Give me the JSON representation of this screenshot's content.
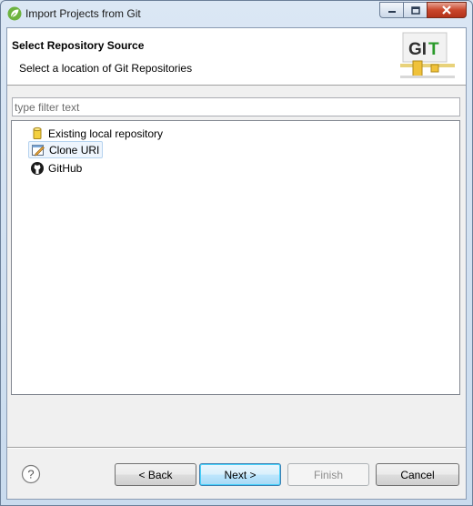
{
  "window": {
    "title": "Import Projects from Git",
    "app_icon": "spring-leaf-icon"
  },
  "banner": {
    "title": "Select Repository Source",
    "description": "Select a location of Git Repositories",
    "logo_text": "GIT"
  },
  "filter": {
    "placeholder": "type filter text",
    "value": ""
  },
  "sources": [
    {
      "label": "Existing local repository",
      "icon": "repository-cylinder-icon",
      "selected": false
    },
    {
      "label": "Clone URI",
      "icon": "clone-uri-icon",
      "selected": true
    },
    {
      "label": "GitHub",
      "icon": "github-icon",
      "selected": false
    }
  ],
  "buttons": {
    "help": "?",
    "back": "< Back",
    "next": "Next >",
    "finish": "Finish",
    "cancel": "Cancel"
  },
  "colors": {
    "selection_border": "#b6d3ef",
    "default_button_border": "#3c7fb1",
    "close_button": "#c9462c"
  }
}
